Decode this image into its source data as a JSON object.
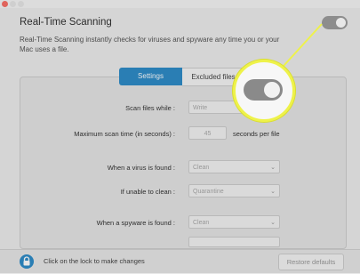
{
  "header": {
    "title": "Real-Time Scanning",
    "description": "Real-Time Scanning instantly checks for viruses and spyware any time you or your Mac uses a file."
  },
  "tabs": [
    {
      "label": "Settings"
    },
    {
      "label": "Excluded files"
    }
  ],
  "settings": {
    "scan_files_label": "Scan files while :",
    "scan_files_value": "Write",
    "max_scan_label": "Maximum scan time (in seconds) :",
    "max_scan_value": "45",
    "max_scan_unit": "seconds per file",
    "virus_found_label": "When a virus is found :",
    "virus_found_value": "Clean",
    "unable_clean_label": "If unable to clean :",
    "unable_clean_value": "Quarantine",
    "spyware_found_label": "When a spyware is found :",
    "spyware_found_value": "Clean"
  },
  "footer": {
    "lock_text": "Click on the lock to make changes",
    "restore_label": "Restore defaults"
  },
  "colors": {
    "accent": "#2f8dc9",
    "highlight": "#eef24a",
    "toggle": "#8a8a8a"
  },
  "icons": [
    "lock-icon",
    "chevron-down-icon"
  ]
}
